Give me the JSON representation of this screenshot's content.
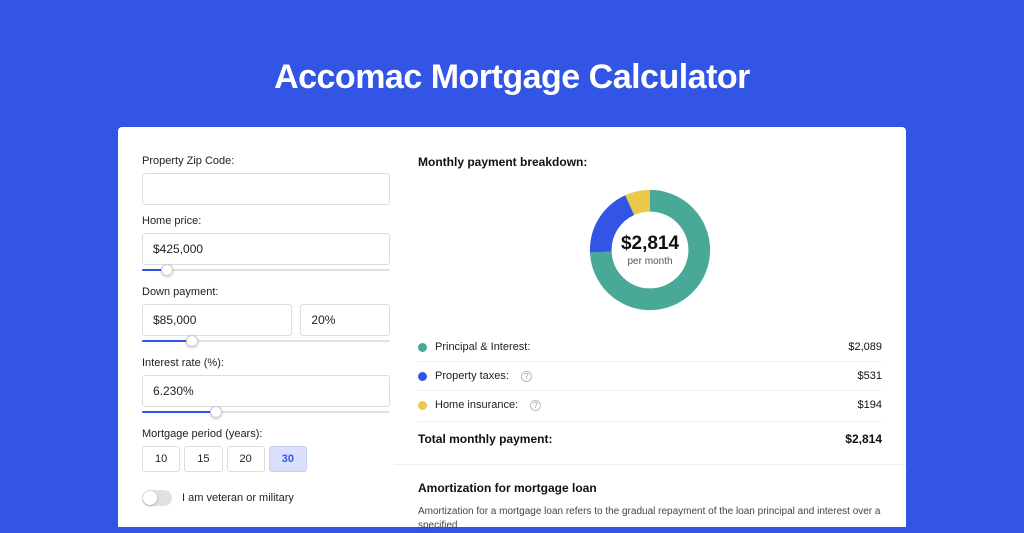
{
  "title": "Accomac Mortgage Calculator",
  "form": {
    "zip_label": "Property Zip Code:",
    "zip_value": "",
    "home_price_label": "Home price:",
    "home_price_value": "$425,000",
    "home_price_slider_pct": 10,
    "down_payment_label": "Down payment:",
    "down_payment_value": "$85,000",
    "down_payment_pct_value": "20%",
    "down_payment_slider_pct": 20,
    "interest_label": "Interest rate (%):",
    "interest_value": "6.230%",
    "interest_slider_pct": 30,
    "period_label": "Mortgage period (years):",
    "periods": [
      "10",
      "15",
      "20",
      "30"
    ],
    "period_selected_index": 3,
    "veteran_label": "I am veteran or military"
  },
  "breakdown": {
    "title": "Monthly payment breakdown:",
    "total_amount": "$2,814",
    "total_sub": "per month",
    "items": [
      {
        "label": "Principal & Interest:",
        "value": "$2,089",
        "color": "#48a999",
        "help": false,
        "pct": 74.2
      },
      {
        "label": "Property taxes:",
        "value": "$531",
        "color": "#3355e6",
        "help": true,
        "pct": 18.9
      },
      {
        "label": "Home insurance:",
        "value": "$194",
        "color": "#e9c84c",
        "help": true,
        "pct": 6.9
      }
    ],
    "total_label": "Total monthly payment:",
    "total_value": "$2,814"
  },
  "amortization": {
    "title": "Amortization for mortgage loan",
    "text": "Amortization for a mortgage loan refers to the gradual repayment of the loan principal and interest over a specified"
  },
  "chart_data": {
    "type": "pie",
    "title": "Monthly payment breakdown",
    "series": [
      {
        "name": "Principal & Interest",
        "value": 2089,
        "color": "#48a999"
      },
      {
        "name": "Property taxes",
        "value": 531,
        "color": "#3355e6"
      },
      {
        "name": "Home insurance",
        "value": 194,
        "color": "#e9c84c"
      }
    ],
    "total": 2814,
    "unit": "USD per month"
  }
}
